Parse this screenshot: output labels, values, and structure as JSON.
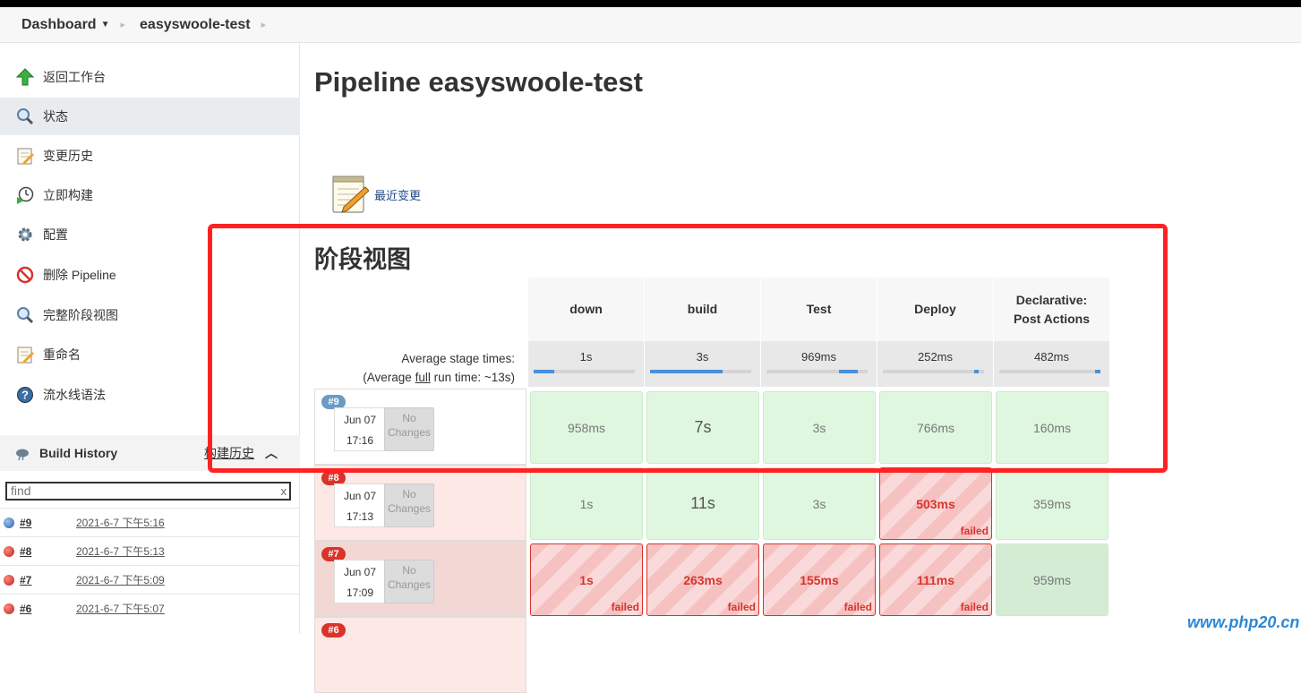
{
  "breadcrumb": {
    "dashboard": "Dashboard",
    "job": "easyswoole-test"
  },
  "sidebar": {
    "items": [
      {
        "label": "返回工作台",
        "icon": "up-arrow-icon"
      },
      {
        "label": "状态",
        "icon": "magnifier-icon"
      },
      {
        "label": "变更历史",
        "icon": "notepad-icon"
      },
      {
        "label": "立即构建",
        "icon": "clock-play-icon"
      },
      {
        "label": "配置",
        "icon": "gear-icon"
      },
      {
        "label": "删除 Pipeline",
        "icon": "no-entry-icon"
      },
      {
        "label": "完整阶段视图",
        "icon": "magnifier-icon"
      },
      {
        "label": "重命名",
        "icon": "notepad-icon"
      },
      {
        "label": "流水线语法",
        "icon": "help-icon"
      }
    ],
    "active_index": 1
  },
  "build_history": {
    "title": "Build History",
    "trend_link": "构建历史",
    "find_placeholder": "find",
    "clear": "x",
    "builds": [
      {
        "number": "#9",
        "date": "2021-6-7 下午5:16",
        "status": "blue"
      },
      {
        "number": "#8",
        "date": "2021-6-7 下午5:13",
        "status": "red"
      },
      {
        "number": "#7",
        "date": "2021-6-7 下午5:09",
        "status": "red"
      },
      {
        "number": "#6",
        "date": "2021-6-7 下午5:07",
        "status": "red"
      }
    ]
  },
  "main": {
    "title": "Pipeline easyswoole-test",
    "recent_changes": "最近变更",
    "stage_view_title": "阶段视图"
  },
  "stage_view": {
    "avg_label_1": "Average stage times:",
    "avg_label_2_pre": "(Average ",
    "avg_label_2_full": "full",
    "avg_label_2_post": " run time: ~13s)",
    "no_changes": "No Changes",
    "failed_label": "failed",
    "stages": [
      {
        "name": "down",
        "avg": "1s",
        "fill_start": 0.0,
        "fill_fraction": 0.2
      },
      {
        "name": "build",
        "avg": "3s",
        "fill_start": 0.0,
        "fill_fraction": 0.72
      },
      {
        "name": "Test",
        "avg": "969ms",
        "fill_start": 0.72,
        "fill_fraction": 0.18
      },
      {
        "name": "Deploy",
        "avg": "252ms",
        "fill_start": 0.9,
        "fill_fraction": 0.05
      },
      {
        "name": "Declarative: Post Actions",
        "avg": "482ms",
        "fill_start": 0.95,
        "fill_fraction": 0.05
      }
    ],
    "runs": [
      {
        "badge": "#9",
        "badge_color": "#6b9ac4",
        "row_bg": "#ffffff",
        "month": "Jun 07",
        "time": "17:16",
        "cells": [
          {
            "value": "958ms",
            "status": "ok"
          },
          {
            "value": "7s",
            "status": "ok"
          },
          {
            "value": "3s",
            "status": "ok"
          },
          {
            "value": "766ms",
            "status": "ok"
          },
          {
            "value": "160ms",
            "status": "ok"
          }
        ]
      },
      {
        "badge": "#8",
        "badge_color": "#d9342b",
        "row_bg": "#fde8e6",
        "month": "Jun 07",
        "time": "17:13",
        "cells": [
          {
            "value": "1s",
            "status": "ok"
          },
          {
            "value": "11s",
            "status": "ok"
          },
          {
            "value": "3s",
            "status": "ok"
          },
          {
            "value": "503ms",
            "status": "failed"
          },
          {
            "value": "359ms",
            "status": "ok"
          }
        ]
      },
      {
        "badge": "#7",
        "badge_color": "#d9342b",
        "row_bg": "#f3d7d4",
        "month": "Jun 07",
        "time": "17:09",
        "cells": [
          {
            "value": "1s",
            "status": "failed"
          },
          {
            "value": "263ms",
            "status": "failed"
          },
          {
            "value": "155ms",
            "status": "failed"
          },
          {
            "value": "111ms",
            "status": "failed"
          },
          {
            "value": "959ms",
            "status": "ok"
          }
        ]
      },
      {
        "badge": "#6",
        "badge_color": "#d9342b",
        "row_bg": "#fde8e6",
        "month": "",
        "time": "",
        "cells": []
      }
    ]
  },
  "watermark": "www.php20.cn"
}
